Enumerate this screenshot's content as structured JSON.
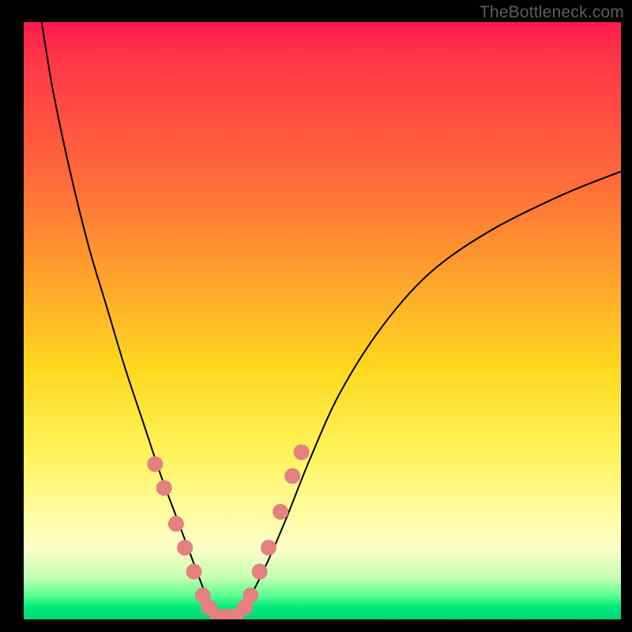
{
  "watermark": "TheBottleneck.com",
  "colors": {
    "dot": "#e58080",
    "curve": "#000000",
    "gradient_top": "#ff1a4c",
    "gradient_bottom": "#00d874"
  },
  "chart_data": {
    "type": "line",
    "title": "",
    "xlabel": "",
    "ylabel": "",
    "xlim": [
      0,
      100
    ],
    "ylim": [
      0,
      100
    ],
    "series": [
      {
        "name": "left-curve",
        "x": [
          3,
          5,
          8,
          11,
          14,
          17,
          20,
          23,
          26,
          29,
          31,
          33
        ],
        "y": [
          100,
          88,
          74,
          62,
          52,
          42,
          33,
          24,
          16,
          8,
          3,
          0
        ]
      },
      {
        "name": "right-curve",
        "x": [
          35,
          38,
          41,
          44,
          48,
          53,
          60,
          68,
          78,
          90,
          100
        ],
        "y": [
          0,
          4,
          10,
          17,
          27,
          38,
          49,
          58,
          65,
          71,
          75
        ]
      }
    ],
    "markers": {
      "name": "highlight-dots",
      "points": [
        {
          "x": 22.0,
          "y": 26
        },
        {
          "x": 23.5,
          "y": 22
        },
        {
          "x": 25.5,
          "y": 16
        },
        {
          "x": 27.0,
          "y": 12
        },
        {
          "x": 28.5,
          "y": 8
        },
        {
          "x": 30.0,
          "y": 4
        },
        {
          "x": 31.0,
          "y": 2
        },
        {
          "x": 32.5,
          "y": 0.5
        },
        {
          "x": 34.0,
          "y": 0.5
        },
        {
          "x": 35.5,
          "y": 0.5
        },
        {
          "x": 37.0,
          "y": 2
        },
        {
          "x": 38.0,
          "y": 4
        },
        {
          "x": 39.5,
          "y": 8
        },
        {
          "x": 41.0,
          "y": 12
        },
        {
          "x": 43.0,
          "y": 18
        },
        {
          "x": 45.0,
          "y": 24
        },
        {
          "x": 46.5,
          "y": 28
        }
      ]
    }
  }
}
